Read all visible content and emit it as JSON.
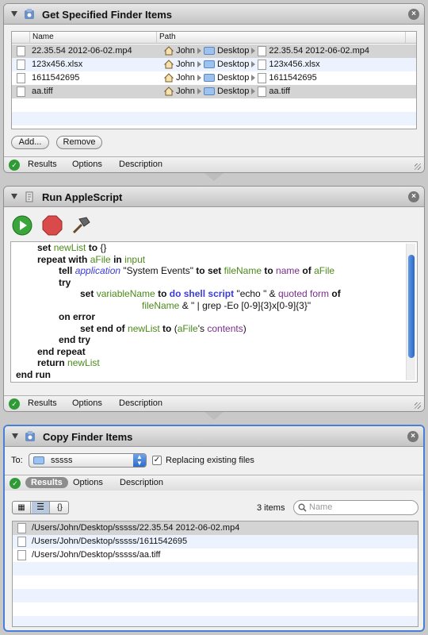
{
  "action1": {
    "title": "Get Specified Finder Items",
    "columns": {
      "name": "Name",
      "path": "Path"
    },
    "rows": [
      {
        "name": "22.35.54 2012-06-02.mp4",
        "user": "John",
        "folder": "Desktop",
        "file": "22.35.54 2012-06-02.mp4"
      },
      {
        "name": "123x456.xlsx",
        "user": "John",
        "folder": "Desktop",
        "file": "123x456.xlsx"
      },
      {
        "name": "1611542695",
        "user": "John",
        "folder": "Desktop",
        "file": "1611542695"
      },
      {
        "name": "aa.tiff",
        "user": "John",
        "folder": "Desktop",
        "file": "aa.tiff"
      }
    ],
    "add_label": "Add...",
    "remove_label": "Remove",
    "footer": {
      "results": "Results",
      "options": "Options",
      "description": "Description"
    }
  },
  "action2": {
    "title": "Run AppleScript",
    "footer": {
      "results": "Results",
      "options": "Options",
      "description": "Description"
    }
  },
  "action3": {
    "title": "Copy Finder Items",
    "to_label": "To:",
    "folder_value": "sssss",
    "replacing_label": "Replacing existing files",
    "replacing_checked": true,
    "footer": {
      "results": "Results",
      "options": "Options",
      "description": "Description"
    },
    "item_count": "3 items",
    "search_placeholder": "Name",
    "results": [
      "/Users/John/Desktop/sssss/22.35.54 2012-06-02.mp4",
      "/Users/John/Desktop/sssss/1611542695",
      "/Users/John/Desktop/sssss/aa.tiff"
    ]
  },
  "colors": {
    "accent": "#4a7fd6",
    "run_green": "#3aa53a",
    "stop_red": "#d94a4a",
    "keyword_blue": "#3b3bd8",
    "variable_green": "#4b8a1a"
  }
}
